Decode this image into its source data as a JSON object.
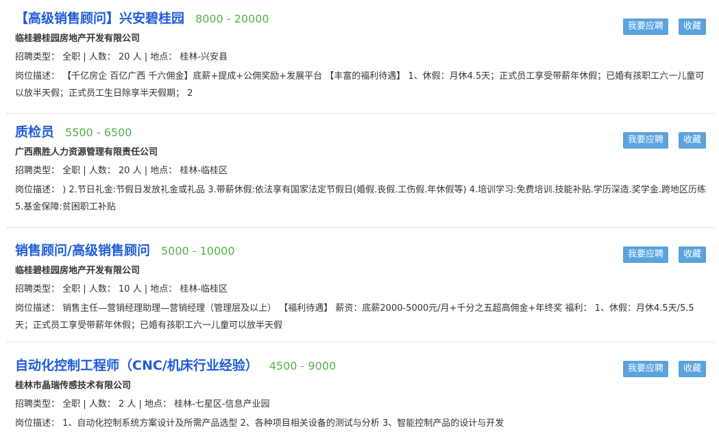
{
  "jobs": [
    {
      "title": "【高级销售顾问】兴安碧桂园",
      "salary": "8000 - 20000",
      "company": "临桂碧桂园房地产开发有限公司",
      "meta": "招聘类型： 全职 | 人数： 20 人 | 地点： 桂林-兴安县",
      "desc": "岗位描述： 【千亿房企 百亿广西 千六佣金】底薪+提成+公佣奖励+发展平台 【丰富的福利待遇】 1、休假：月休4.5天；正式员工享受带薪年休假；已婚有孩职工六一儿童可以放半天假；正式员工生日除享半天假期； 2",
      "apply": "我要应聘",
      "save": "收藏"
    },
    {
      "title": "质检员",
      "salary": "5500 - 6500",
      "company": "广西鼎胜人力资源管理有限责任公司",
      "meta": "招聘类型： 全职 | 人数： 20 人 | 地点： 桂林-临桂区",
      "desc": "岗位描述： ) 2.节日礼金:节假日发放礼金或礼品 3.带薪休假:依法享有国家法定节假日(婚假.丧假.工伤假.年休假等) 4.培训学习:免费培训.技能补贴.学历深造.奖学金.跨地区历练 5.基金保障:贫困职工补贴",
      "apply": "我要应聘",
      "save": "收藏"
    },
    {
      "title": "销售顾问/高级销售顾问",
      "salary": "5000 - 10000",
      "company": "临桂碧桂园房地产开发有限公司",
      "meta": "招聘类型： 全职 | 人数： 10 人 | 地点： 桂林-临桂区",
      "desc": "岗位描述： 销售主任—营销经理助理—营销经理（管理层及以上） 【福利待遇】 薪资：底薪2000-5000元/月+千分之五超高佣金+年终奖 福利： 1、休假：月休4.5天/5.5天；正式员工享受带薪年休假；已婚有孩职工六一儿童可以放半天假",
      "apply": "我要应聘",
      "save": "收藏"
    },
    {
      "title": "自动化控制工程师（CNC/机床行业经验）",
      "salary": "4500 - 9000",
      "company": "桂林市晶瑞传感技术有限公司",
      "meta": "招聘类型： 全职 | 人数： 2 人 | 地点： 桂林-七星区-信息产业园",
      "desc": "岗位描述： 1、自动化控制系统方案设计及所需产品选型 2、各种项目相关设备的测试与分析 3、智能控制产品的设计与开发",
      "apply": "我要应聘",
      "save": "收藏"
    }
  ]
}
